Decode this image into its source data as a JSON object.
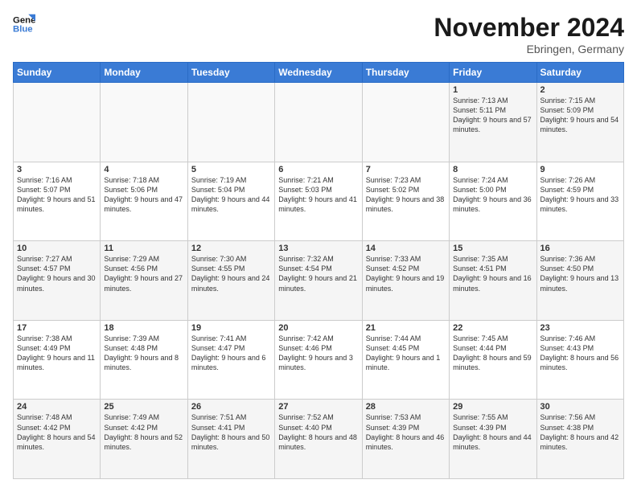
{
  "logo": {
    "line1": "General",
    "line2": "Blue"
  },
  "title": "November 2024",
  "location": "Ebringen, Germany",
  "days_of_week": [
    "Sunday",
    "Monday",
    "Tuesday",
    "Wednesday",
    "Thursday",
    "Friday",
    "Saturday"
  ],
  "weeks": [
    [
      {
        "day": "",
        "info": ""
      },
      {
        "day": "",
        "info": ""
      },
      {
        "day": "",
        "info": ""
      },
      {
        "day": "",
        "info": ""
      },
      {
        "day": "",
        "info": ""
      },
      {
        "day": "1",
        "info": "Sunrise: 7:13 AM\nSunset: 5:11 PM\nDaylight: 9 hours\nand 57 minutes."
      },
      {
        "day": "2",
        "info": "Sunrise: 7:15 AM\nSunset: 5:09 PM\nDaylight: 9 hours\nand 54 minutes."
      }
    ],
    [
      {
        "day": "3",
        "info": "Sunrise: 7:16 AM\nSunset: 5:07 PM\nDaylight: 9 hours\nand 51 minutes."
      },
      {
        "day": "4",
        "info": "Sunrise: 7:18 AM\nSunset: 5:06 PM\nDaylight: 9 hours\nand 47 minutes."
      },
      {
        "day": "5",
        "info": "Sunrise: 7:19 AM\nSunset: 5:04 PM\nDaylight: 9 hours\nand 44 minutes."
      },
      {
        "day": "6",
        "info": "Sunrise: 7:21 AM\nSunset: 5:03 PM\nDaylight: 9 hours\nand 41 minutes."
      },
      {
        "day": "7",
        "info": "Sunrise: 7:23 AM\nSunset: 5:02 PM\nDaylight: 9 hours\nand 38 minutes."
      },
      {
        "day": "8",
        "info": "Sunrise: 7:24 AM\nSunset: 5:00 PM\nDaylight: 9 hours\nand 36 minutes."
      },
      {
        "day": "9",
        "info": "Sunrise: 7:26 AM\nSunset: 4:59 PM\nDaylight: 9 hours\nand 33 minutes."
      }
    ],
    [
      {
        "day": "10",
        "info": "Sunrise: 7:27 AM\nSunset: 4:57 PM\nDaylight: 9 hours\nand 30 minutes."
      },
      {
        "day": "11",
        "info": "Sunrise: 7:29 AM\nSunset: 4:56 PM\nDaylight: 9 hours\nand 27 minutes."
      },
      {
        "day": "12",
        "info": "Sunrise: 7:30 AM\nSunset: 4:55 PM\nDaylight: 9 hours\nand 24 minutes."
      },
      {
        "day": "13",
        "info": "Sunrise: 7:32 AM\nSunset: 4:54 PM\nDaylight: 9 hours\nand 21 minutes."
      },
      {
        "day": "14",
        "info": "Sunrise: 7:33 AM\nSunset: 4:52 PM\nDaylight: 9 hours\nand 19 minutes."
      },
      {
        "day": "15",
        "info": "Sunrise: 7:35 AM\nSunset: 4:51 PM\nDaylight: 9 hours\nand 16 minutes."
      },
      {
        "day": "16",
        "info": "Sunrise: 7:36 AM\nSunset: 4:50 PM\nDaylight: 9 hours\nand 13 minutes."
      }
    ],
    [
      {
        "day": "17",
        "info": "Sunrise: 7:38 AM\nSunset: 4:49 PM\nDaylight: 9 hours\nand 11 minutes."
      },
      {
        "day": "18",
        "info": "Sunrise: 7:39 AM\nSunset: 4:48 PM\nDaylight: 9 hours\nand 8 minutes."
      },
      {
        "day": "19",
        "info": "Sunrise: 7:41 AM\nSunset: 4:47 PM\nDaylight: 9 hours\nand 6 minutes."
      },
      {
        "day": "20",
        "info": "Sunrise: 7:42 AM\nSunset: 4:46 PM\nDaylight: 9 hours\nand 3 minutes."
      },
      {
        "day": "21",
        "info": "Sunrise: 7:44 AM\nSunset: 4:45 PM\nDaylight: 9 hours\nand 1 minute."
      },
      {
        "day": "22",
        "info": "Sunrise: 7:45 AM\nSunset: 4:44 PM\nDaylight: 8 hours\nand 59 minutes."
      },
      {
        "day": "23",
        "info": "Sunrise: 7:46 AM\nSunset: 4:43 PM\nDaylight: 8 hours\nand 56 minutes."
      }
    ],
    [
      {
        "day": "24",
        "info": "Sunrise: 7:48 AM\nSunset: 4:42 PM\nDaylight: 8 hours\nand 54 minutes."
      },
      {
        "day": "25",
        "info": "Sunrise: 7:49 AM\nSunset: 4:42 PM\nDaylight: 8 hours\nand 52 minutes."
      },
      {
        "day": "26",
        "info": "Sunrise: 7:51 AM\nSunset: 4:41 PM\nDaylight: 8 hours\nand 50 minutes."
      },
      {
        "day": "27",
        "info": "Sunrise: 7:52 AM\nSunset: 4:40 PM\nDaylight: 8 hours\nand 48 minutes."
      },
      {
        "day": "28",
        "info": "Sunrise: 7:53 AM\nSunset: 4:39 PM\nDaylight: 8 hours\nand 46 minutes."
      },
      {
        "day": "29",
        "info": "Sunrise: 7:55 AM\nSunset: 4:39 PM\nDaylight: 8 hours\nand 44 minutes."
      },
      {
        "day": "30",
        "info": "Sunrise: 7:56 AM\nSunset: 4:38 PM\nDaylight: 8 hours\nand 42 minutes."
      }
    ]
  ]
}
